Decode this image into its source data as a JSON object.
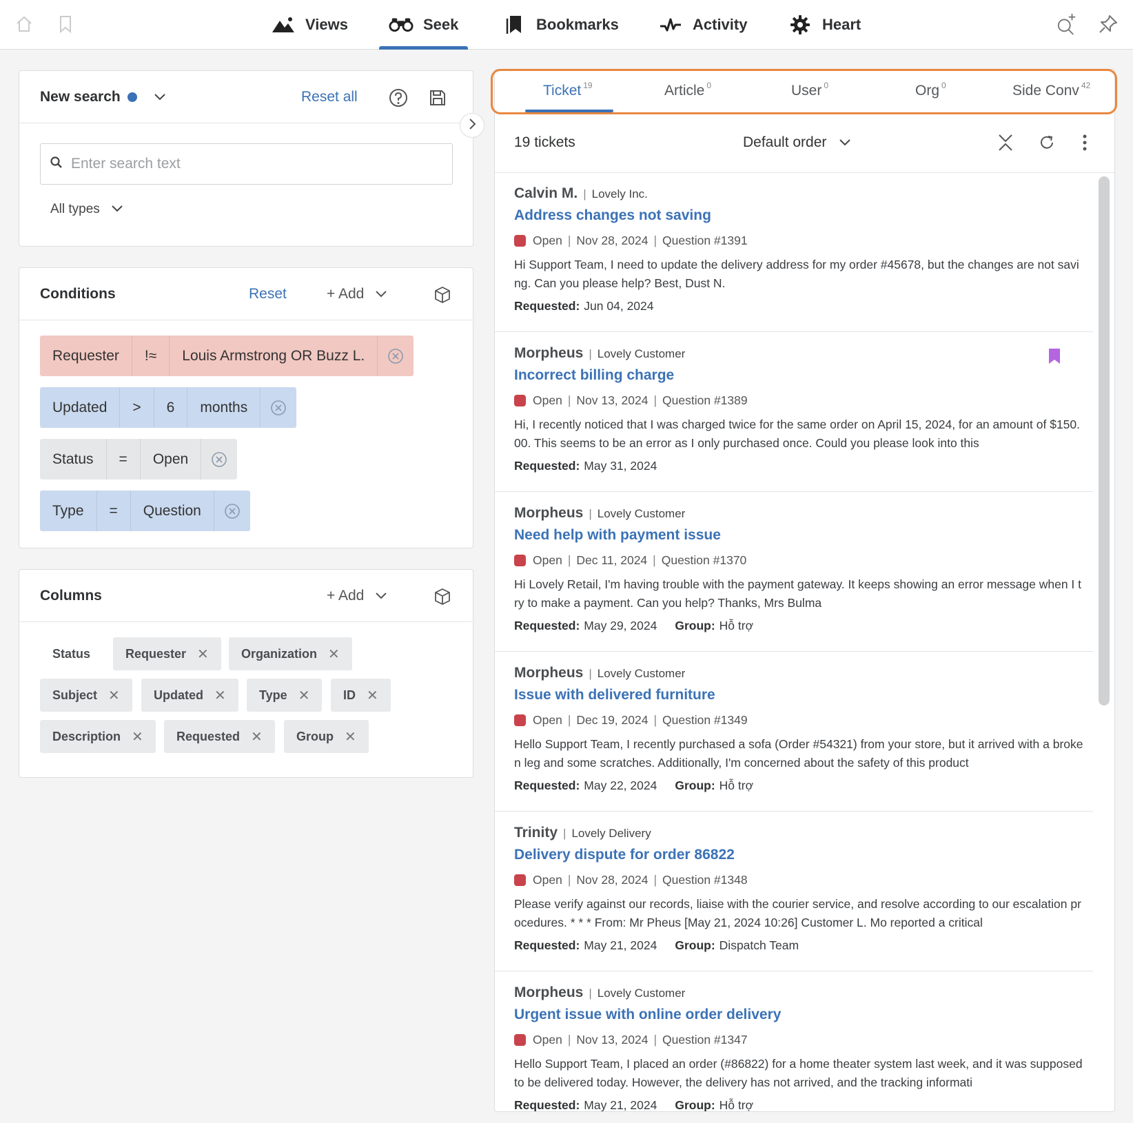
{
  "nav": {
    "tabs": [
      {
        "label": "Views",
        "icon": "mountains-icon"
      },
      {
        "label": "Seek",
        "icon": "binoculars-icon",
        "active": true
      },
      {
        "label": "Bookmarks",
        "icon": "bookmark-icon"
      },
      {
        "label": "Activity",
        "icon": "activity-pulse-icon"
      },
      {
        "label": "Heart",
        "icon": "gear-icon"
      }
    ],
    "left_icons": [
      "home-icon",
      "bookmark-outline-icon"
    ],
    "right_icons": [
      "search-plus-icon",
      "pin-icon"
    ]
  },
  "search_card": {
    "title": "New search",
    "reset_label": "Reset all",
    "placeholder": "Enter search text",
    "types_label": "All types"
  },
  "conditions": {
    "title": "Conditions",
    "reset_label": "Reset",
    "add_label": "+ Add",
    "items": [
      {
        "field": "Requester",
        "op": "!≈",
        "value": "Louis Armstrong OR Buzz L.",
        "color": "#f2c8c2"
      },
      {
        "field": "Updated",
        "op": ">",
        "value": "6",
        "unit": "months",
        "color": "#c9d9ef"
      },
      {
        "field": "Status",
        "op": "=",
        "value": "Open",
        "color": "#e6e7e8"
      },
      {
        "field": "Type",
        "op": "=",
        "value": "Question",
        "color": "#c9d9ef"
      }
    ]
  },
  "columns": {
    "title": "Columns",
    "add_label": "+ Add",
    "items": [
      "Status",
      "Requester",
      "Organization",
      "Subject",
      "Updated",
      "Type",
      "ID",
      "Description",
      "Requested",
      "Group"
    ]
  },
  "results": {
    "tabs": [
      {
        "label": "Ticket",
        "count": "19"
      },
      {
        "label": "Article",
        "count": "0"
      },
      {
        "label": "User",
        "count": "0"
      },
      {
        "label": "Org",
        "count": "0"
      },
      {
        "label": "Side Conv",
        "count": "42"
      }
    ],
    "count_label": "19 tickets",
    "order_label": "Default order",
    "requested_label": "Requested:",
    "group_label": "Group:",
    "tickets": [
      {
        "requester": "Calvin M.",
        "org": "Lovely Inc.",
        "subject": "Address changes not saving",
        "status": "Open",
        "date": "Nov 28, 2024",
        "type_id": "Question #1391",
        "desc": "Hi Support Team, I need to update the delivery address for my order #45678, but the changes are not saving. Can you please help? Best, Dust N.",
        "requested": "Jun 04, 2024",
        "group": ""
      },
      {
        "requester": "Morpheus",
        "org": "Lovely Customer",
        "subject": "Incorrect billing charge",
        "status": "Open",
        "date": "Nov 13, 2024",
        "type_id": "Question #1389",
        "desc": "Hi, I recently noticed that I was charged twice for the same order on April 15, 2024, for an amount of $150.00. This seems to be an error as I only purchased once. Could you please look into this",
        "requested": "May 31, 2024",
        "group": "",
        "bookmarked": true
      },
      {
        "requester": "Morpheus",
        "org": "Lovely Customer",
        "subject": "Need help with payment issue",
        "status": "Open",
        "date": "Dec 11, 2024",
        "type_id": "Question #1370",
        "desc": "Hi Lovely Retail, I'm having trouble with the payment gateway. It keeps showing an error message when I try to make a payment. Can you help? Thanks, Mrs Bulma",
        "requested": "May 29, 2024",
        "group": "Hỗ trợ"
      },
      {
        "requester": "Morpheus",
        "org": "Lovely Customer",
        "subject": "Issue with delivered furniture",
        "status": "Open",
        "date": "Dec 19, 2024",
        "type_id": "Question #1349",
        "desc": "Hello Support Team, I recently purchased a sofa (Order #54321) from your store, but it arrived with a broken leg and some scratches. Additionally, I'm concerned about the safety of this product",
        "requested": "May 22, 2024",
        "group": "Hỗ trợ"
      },
      {
        "requester": "Trinity",
        "org": "Lovely Delivery",
        "subject": "Delivery dispute for order 86822",
        "status": "Open",
        "date": "Nov 28, 2024",
        "type_id": "Question #1348",
        "desc": "Please verify against our records, liaise with the courier service, and resolve according to our escalation procedures. * * * From: Mr Pheus [May 21, 2024 10:26] Customer L. Mo reported a critical",
        "requested": "May 21, 2024",
        "group": "Dispatch Team"
      },
      {
        "requester": "Morpheus",
        "org": "Lovely Customer",
        "subject": "Urgent issue with online order delivery",
        "status": "Open",
        "date": "Nov 13, 2024",
        "type_id": "Question #1347",
        "desc": "Hello Support Team, I placed an order (#86822) for a home theater system last week, and it was supposed to be delivered today. However, the delivery has not arrived, and the tracking informati",
        "requested": "May 21, 2024",
        "group": "Hỗ trợ"
      }
    ]
  },
  "colors": {
    "accent": "#3b72b6",
    "status_open": "#c8434b",
    "bookmark": "#b565e0",
    "highlight": "#e9873e"
  }
}
